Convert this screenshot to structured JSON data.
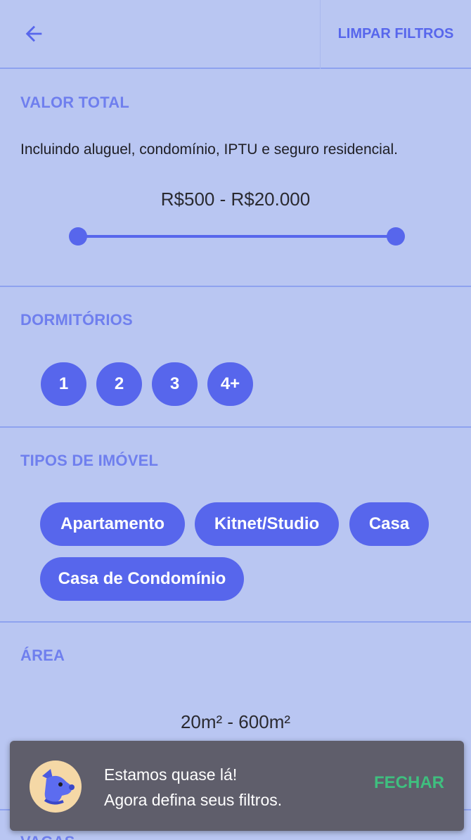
{
  "header": {
    "back_icon": "arrow-left-icon",
    "clear_label": "LIMPAR FILTROS"
  },
  "valor_total": {
    "title": "VALOR TOTAL",
    "description": "Incluindo aluguel, condomínio, IPTU e seguro residencial.",
    "range_label": "R$500 - R$20.000",
    "range_fraction": [
      0,
      1
    ]
  },
  "dormitorios": {
    "title": "DORMITÓRIOS",
    "options": [
      "1",
      "2",
      "3",
      "4+"
    ]
  },
  "tipos": {
    "title": "TIPOS DE IMÓVEL",
    "options": [
      "Apartamento",
      "Kitnet/Studio",
      "Casa",
      "Casa de Condomínio"
    ]
  },
  "area": {
    "title": "ÁREA",
    "range_label": "20m² - 600m²",
    "range_fraction": [
      0,
      1
    ]
  },
  "vagas": {
    "title": "VAGAS"
  },
  "toast": {
    "line1": "Estamos quase lá!",
    "line2": "Agora defina seus filtros.",
    "close_label": "FECHAR",
    "avatar_icon": "dog-mascot-icon"
  },
  "colors": {
    "accent": "#5766ec",
    "background": "#b9c6f2",
    "section_title": "#6f7fee",
    "toast_bg": "#5f5e6b",
    "toast_action": "#3fbf7f"
  }
}
